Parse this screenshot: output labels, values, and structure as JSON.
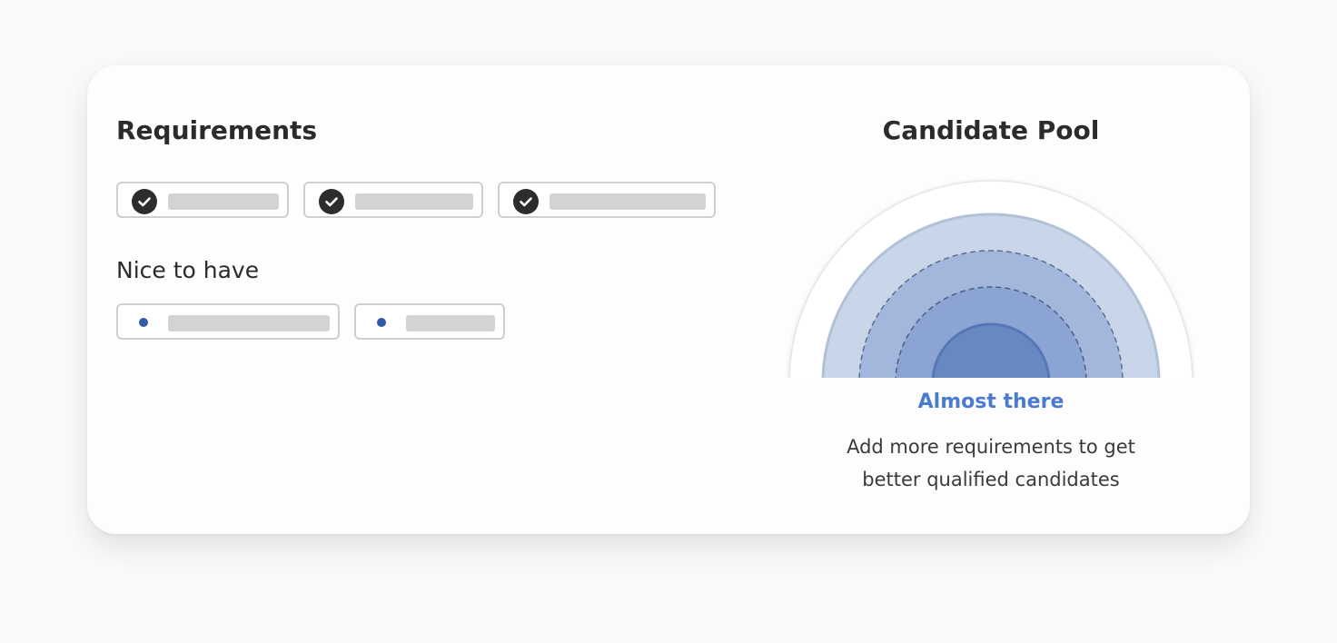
{
  "requirements": {
    "title": "Requirements",
    "chips": [
      {
        "icon": "check-circle-icon"
      },
      {
        "icon": "check-circle-icon"
      },
      {
        "icon": "check-circle-icon"
      }
    ]
  },
  "nice_to_have": {
    "title": "Nice to have",
    "chips": [
      {
        "icon": "bullet-dot-icon"
      },
      {
        "icon": "bullet-dot-icon"
      }
    ]
  },
  "candidate_pool": {
    "title": "Candidate Pool",
    "status": "Almost there",
    "message": "Add more requirements to get better qualified candidates",
    "colors": {
      "ring_outer": "#c9d5e8",
      "ring_second": "#a3b6dc",
      "ring_third": "#8ca4d3",
      "ring_core": "#6888c2",
      "status_accent": "#4b7bd0"
    }
  },
  "colors": {
    "check_fill": "#2d2d2d",
    "bullet": "#2e5aa8",
    "placeholder_bar": "#d4d3d3"
  }
}
